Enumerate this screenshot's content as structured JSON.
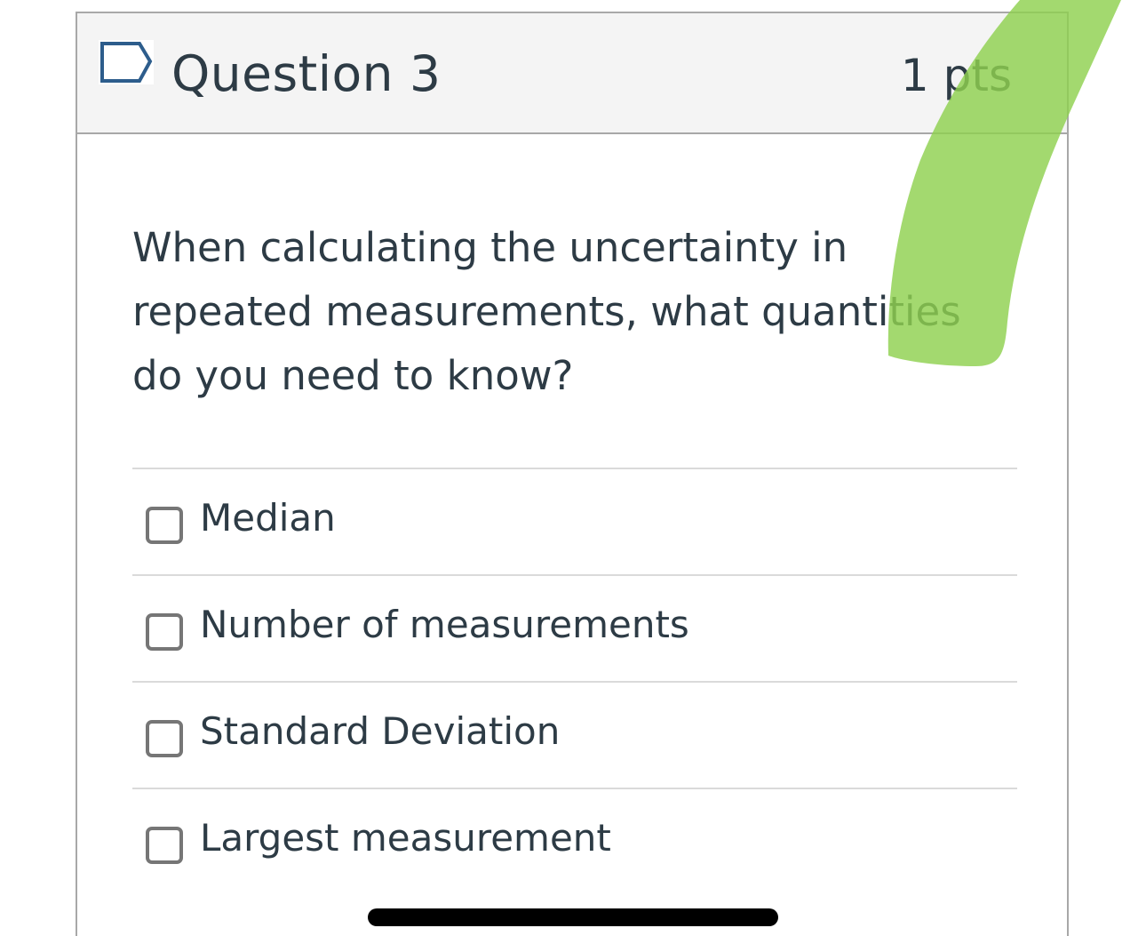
{
  "question": {
    "title": "Question 3",
    "points": "1 pts",
    "text": "When calculating the uncertainty in repeated measurements, what quantities do you need to know?",
    "flag_icon": "flag-outline-icon"
  },
  "answers": [
    {
      "label": "Median",
      "checked": false
    },
    {
      "label": "Number of measurements",
      "checked": false
    },
    {
      "label": "Standard Deviation",
      "checked": false
    },
    {
      "label": "Largest measurement",
      "checked": false
    }
  ],
  "annotation": {
    "type": "green-highlighter-stroke",
    "color": "#8fd14f"
  }
}
